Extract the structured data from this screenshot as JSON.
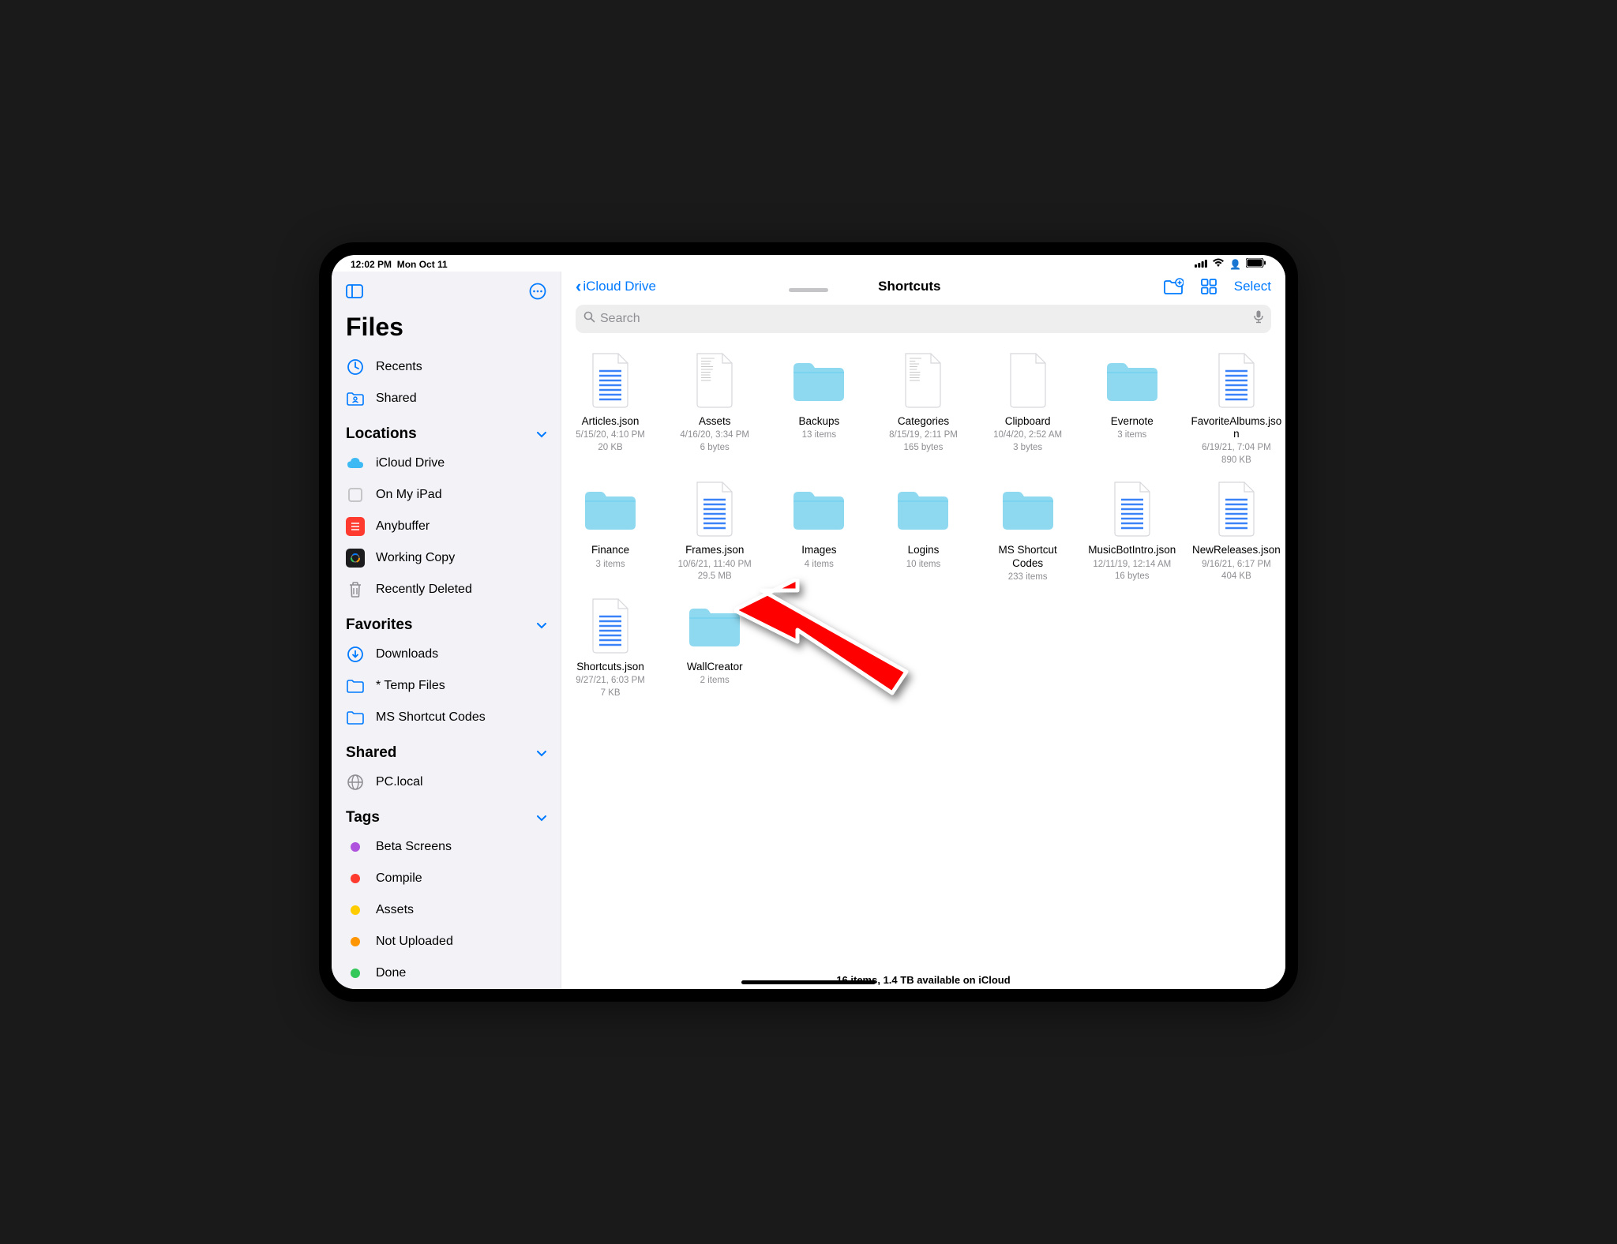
{
  "status": {
    "time": "12:02 PM",
    "date": "Mon Oct 11"
  },
  "app_title": "Files",
  "sidebar": {
    "top_items": [
      {
        "label": "Recents",
        "icon": "clock"
      },
      {
        "label": "Shared",
        "icon": "folder-person"
      }
    ],
    "sections": [
      {
        "title": "Locations",
        "items": [
          {
            "label": "iCloud Drive",
            "icon": "icloud"
          },
          {
            "label": "On My iPad",
            "icon": "ipad"
          },
          {
            "label": "Anybuffer",
            "icon": "app-red"
          },
          {
            "label": "Working Copy",
            "icon": "app-dark"
          },
          {
            "label": "Recently Deleted",
            "icon": "trash"
          }
        ]
      },
      {
        "title": "Favorites",
        "items": [
          {
            "label": "Downloads",
            "icon": "download"
          },
          {
            "label": "* Temp Files",
            "icon": "folder"
          },
          {
            "label": "MS Shortcut Codes",
            "icon": "folder"
          }
        ]
      },
      {
        "title": "Shared",
        "items": [
          {
            "label": "PC.local",
            "icon": "globe"
          }
        ]
      },
      {
        "title": "Tags",
        "items": [
          {
            "label": "Beta Screens",
            "icon": "tag",
            "color": "#af52de"
          },
          {
            "label": "Compile",
            "icon": "tag",
            "color": "#ff3b30"
          },
          {
            "label": "Assets",
            "icon": "tag",
            "color": "#ffcc00"
          },
          {
            "label": "Not Uploaded",
            "icon": "tag",
            "color": "#ff9500"
          },
          {
            "label": "Done",
            "icon": "tag",
            "color": "#34c759"
          }
        ]
      }
    ]
  },
  "toolbar": {
    "back_label": "iCloud Drive",
    "title": "Shortcuts",
    "select_label": "Select"
  },
  "search": {
    "placeholder": "Search"
  },
  "items": [
    {
      "name": "Articles.json",
      "type": "json",
      "line1": "5/15/20, 4:10 PM",
      "line2": "20 KB"
    },
    {
      "name": "Assets",
      "type": "text",
      "line1": "4/16/20, 3:34 PM",
      "line2": "6 bytes"
    },
    {
      "name": "Backups",
      "type": "folder",
      "line1": "13 items",
      "line2": ""
    },
    {
      "name": "Categories",
      "type": "text",
      "line1": "8/15/19, 2:11 PM",
      "line2": "165 bytes"
    },
    {
      "name": "Clipboard",
      "type": "blank",
      "line1": "10/4/20, 2:52 AM",
      "line2": "3 bytes"
    },
    {
      "name": "Evernote",
      "type": "folder",
      "line1": "3 items",
      "line2": ""
    },
    {
      "name": "FavoriteAlbums.json",
      "type": "json",
      "line1": "6/19/21, 7:04 PM",
      "line2": "890 KB"
    },
    {
      "name": "Finance",
      "type": "folder",
      "line1": "3 items",
      "line2": ""
    },
    {
      "name": "Frames.json",
      "type": "json",
      "line1": "10/6/21, 11:40 PM",
      "line2": "29.5 MB"
    },
    {
      "name": "Images",
      "type": "folder",
      "line1": "4 items",
      "line2": ""
    },
    {
      "name": "Logins",
      "type": "folder",
      "line1": "10 items",
      "line2": ""
    },
    {
      "name": "MS Shortcut Codes",
      "type": "folder",
      "line1": "233 items",
      "line2": ""
    },
    {
      "name": "MusicBotIntro.json",
      "type": "json",
      "line1": "12/11/19, 12:14 AM",
      "line2": "16 bytes"
    },
    {
      "name": "NewReleases.json",
      "type": "json",
      "line1": "9/16/21, 6:17 PM",
      "line2": "404 KB"
    },
    {
      "name": "Shortcuts.json",
      "type": "json",
      "line1": "9/27/21, 6:03 PM",
      "line2": "7 KB"
    },
    {
      "name": "WallCreator",
      "type": "folder",
      "line1": "2 items",
      "line2": ""
    }
  ],
  "footer": "16 items, 1.4 TB available on iCloud"
}
